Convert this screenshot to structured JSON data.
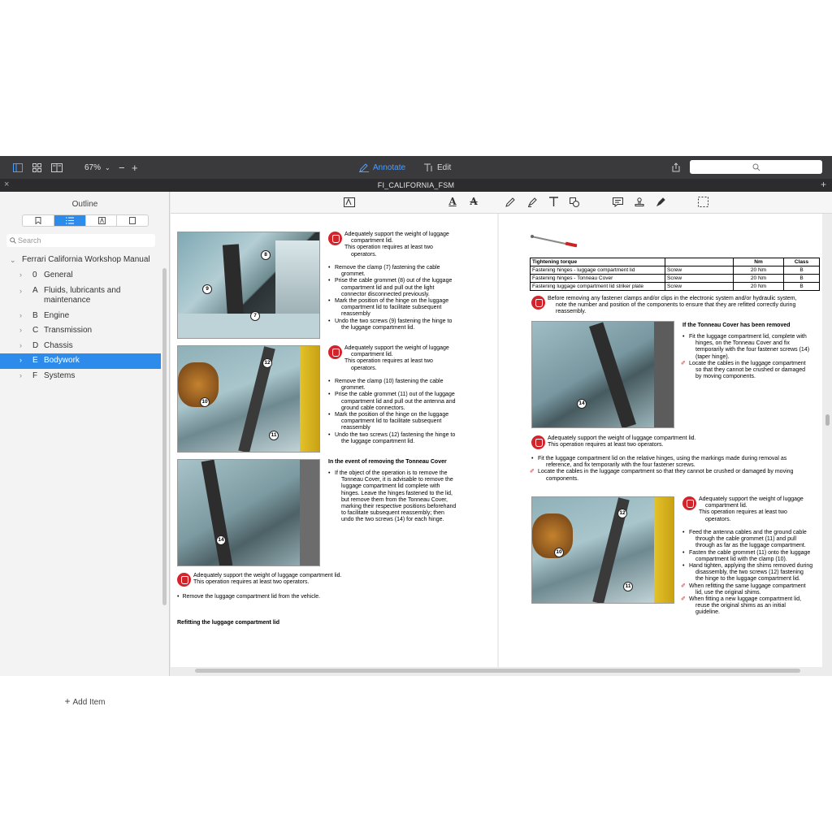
{
  "toolbar": {
    "zoom": "67%",
    "annotate_label": "Annotate",
    "edit_label": "Edit",
    "accent": "#4a9fff"
  },
  "window": {
    "title": "FI_CALIFORNIA_FSM"
  },
  "sidebar": {
    "title": "Outline",
    "search_placeholder": "Search",
    "root": "Ferrari California Workshop Manual",
    "items": [
      {
        "code": "0",
        "label": "General"
      },
      {
        "code": "A",
        "label": "Fluids, lubricants and maintenance"
      },
      {
        "code": "B",
        "label": "Engine"
      },
      {
        "code": "C",
        "label": "Transmission"
      },
      {
        "code": "D",
        "label": "Chassis"
      },
      {
        "code": "E",
        "label": "Bodywork"
      },
      {
        "code": "F",
        "label": "Systems"
      }
    ],
    "selected_index": 5,
    "add_item_label": "Add Item",
    "selection_color": "#2d8ceb"
  },
  "doc": {
    "left": {
      "callouts": [
        "8",
        "9",
        "7",
        "12",
        "10",
        "11",
        "14"
      ],
      "block1": {
        "warn": [
          "Adequately support the weight of luggage",
          "compartment lid.",
          "This operation requires at least two",
          "operators."
        ],
        "bullets": [
          [
            "Remove the clamp (7) fastening the cable",
            "grommet."
          ],
          [
            "Prise the cable grommet (8) out of the luggage",
            "compartment lid and pull out the light",
            "connector disconnected previously."
          ],
          [
            "Mark the position of the hinge on the luggage",
            "compartment lid to facilitate subsequent",
            "reassembly"
          ],
          [
            "Undo the two screws (9) fastening the hinge to",
            "the luggage compartment lid."
          ]
        ]
      },
      "block2": {
        "warn": [
          "Adequately support the weight of luggage",
          "compartment lid.",
          "This operation requires at least two",
          "operators."
        ],
        "bullets": [
          [
            "Remove the clamp (10) fastening the cable",
            "grommet."
          ],
          [
            "Prise the cable grommet (11) out of the luggage",
            "compartment lid and pull out the antenna and",
            "ground cable connectors."
          ],
          [
            "Mark the position of the hinge on the luggage",
            "compartment lid to facilitate subsequent",
            "reassembly"
          ],
          [
            "Undo the two screws (12) fastening the hinge to",
            "the luggage compartment lid."
          ]
        ]
      },
      "block3": {
        "heading": "In the event of removing the Tonneau Cover",
        "bullets": [
          [
            "If the object of the operation is to remove the",
            "Tonneau Cover, it is advisable to remove the",
            "luggage compartment lid complete with",
            "hinges. Leave the hinges fastened to the lid,",
            "but remove them from the Tonneau Cover,",
            "marking their respective positions beforehand",
            "to facilitate subsequent reassembly; then",
            "undo the two screws (14) for each hinge."
          ]
        ]
      },
      "bottom_warn": [
        "Adequately support the weight of luggage compartment lid.",
        "This operation requires at least two operators."
      ],
      "bottom_bullet": "Remove the luggage compartment lid from the vehicle.",
      "bottom_heading": "Refitting the luggage compartment lid"
    },
    "right": {
      "table": {
        "headers": [
          "Tightening torque",
          "",
          "Nm",
          "Class"
        ],
        "rows": [
          [
            "Fastening hinges - luggage compartment lid",
            "Screw",
            "20 Nm",
            "B"
          ],
          [
            "Fastening hinges - Tonneau Cover",
            "Screw",
            "20 Nm",
            "B"
          ],
          [
            "Fastening luggage compartment lid striker plate",
            "Screw",
            "20 Nm",
            "B"
          ]
        ]
      },
      "warn1": [
        "Before removing any fastener clamps and/or clips in the electronic system and/or hydraulic system,",
        "note the number and position of the components to ensure that they are refitted correctly during",
        "reassembly."
      ],
      "block1": {
        "heading": "If the Tonneau Cover has been removed",
        "bullets": [
          [
            "Fit the luggage compartment lid, complete with",
            "hinges, on the Tonneau Cover and fix",
            "temporarily with the four fastener screws (14)",
            "(taper hinge)."
          ]
        ],
        "pen": [
          "Locate the cables in the luggage compartment",
          "so that they cannot be crushed or damaged",
          "by moving components."
        ]
      },
      "warn2": [
        "Adequately support the weight of luggage compartment lid.",
        "This operation requires at least two operators."
      ],
      "bullet2": [
        "Fit the luggage compartment lid on the relative hinges, using the markings made during removal as",
        "reference, and fix temporarily with the four fastener screws."
      ],
      "pen2": [
        "Locate the cables in the luggage compartment so that they cannot be crushed or damaged by moving",
        "components."
      ],
      "block3": {
        "warn": [
          "Adequately support the weight of luggage",
          "compartment lid.",
          "This operation requires at least two",
          "operators."
        ],
        "bullets": [
          [
            "Feed the antenna cables and the ground cable",
            "through the cable grommet (11) and pull",
            "through as far as the luggage compartment."
          ],
          [
            "Fasten the cable grommet (11) onto the luggage",
            "compartment lid with the clamp (10)."
          ],
          [
            "Hand tighten, applying the shims removed during",
            "disassembly, the two screws (12) fastening",
            "the hinge to the luggage compartment lid."
          ]
        ],
        "pen": [
          [
            "When refitting the same luggage compartment",
            "lid, use the original shims."
          ],
          [
            "When fitting a new luggage compartment lid,",
            "reuse the original shims as an initial",
            "guideline."
          ]
        ]
      },
      "callouts": [
        "14",
        "12",
        "10",
        "11"
      ]
    }
  }
}
